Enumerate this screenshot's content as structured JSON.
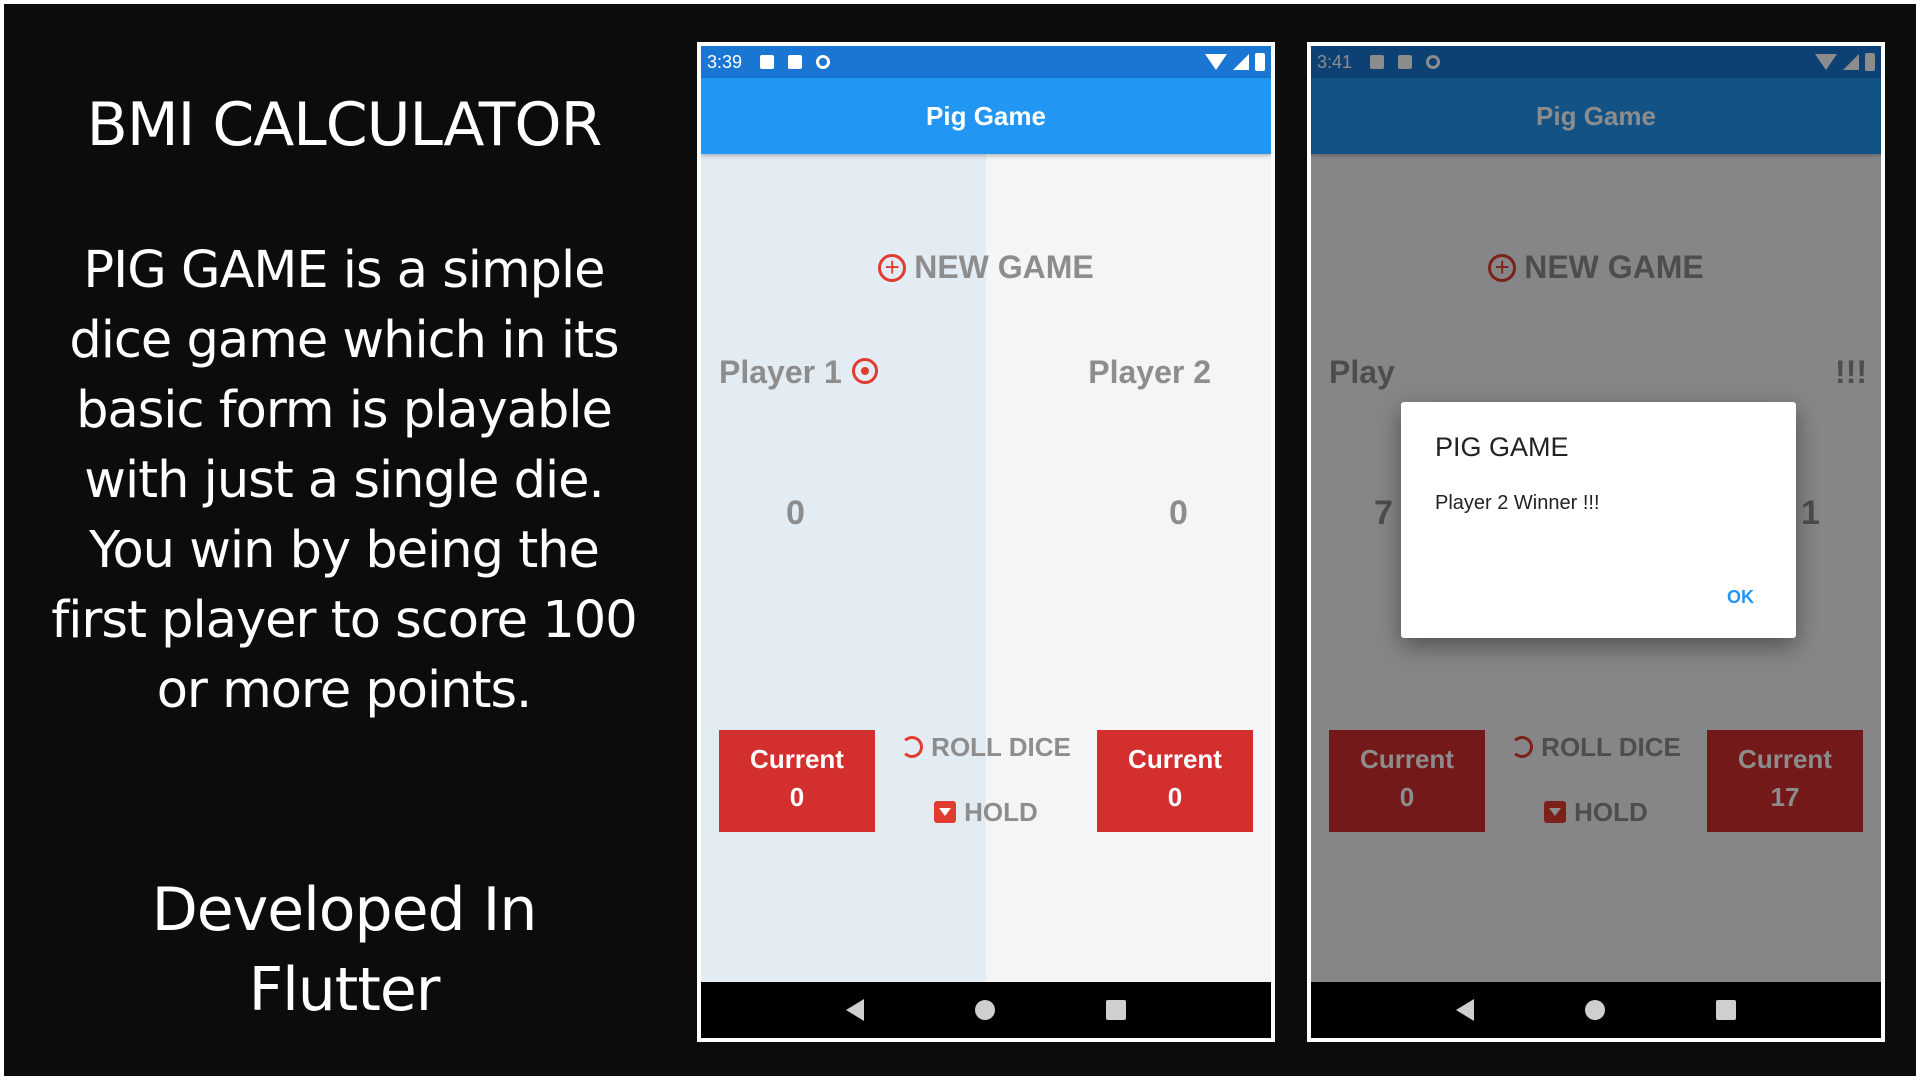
{
  "left_panel": {
    "title": "BMI CALCULATOR",
    "description": "PIG GAME is a simple dice game which in its basic form is playable with just a single die. You win by being the first player to score 100 or more points.",
    "developed_line1": "Developed In",
    "developed_line2": "Flutter"
  },
  "screen1": {
    "status_time": "3:39",
    "app_title": "Pig Game",
    "new_game_label": "NEW GAME",
    "player1_name": "Player 1",
    "player2_name": "Player 2",
    "player1_score": "0",
    "player2_score": "0",
    "current_label": "Current",
    "player1_current": "0",
    "player2_current": "0",
    "roll_label": "ROLL DICE",
    "hold_label": "HOLD"
  },
  "screen2": {
    "status_time": "3:41",
    "app_title": "Pig Game",
    "new_game_label": "NEW GAME",
    "player1_name_visible": "Play",
    "player2_name_visible": "!!!",
    "player1_score_visible": "7",
    "player2_score_visible": "1",
    "current_label": "Current",
    "player1_current": "0",
    "player2_current": "17",
    "roll_label": "ROLL DICE",
    "hold_label": "HOLD",
    "dialog": {
      "title": "PIG GAME",
      "message": "Player 2 Winner !!!",
      "ok_label": "OK"
    }
  },
  "colors": {
    "appbar": "#2196f3",
    "statusbar": "#1976d2",
    "accent_red": "#d32f2f",
    "icon_red": "#e03c31",
    "panel_left": "#e3ebf3",
    "panel_right": "#f4f5f7"
  }
}
